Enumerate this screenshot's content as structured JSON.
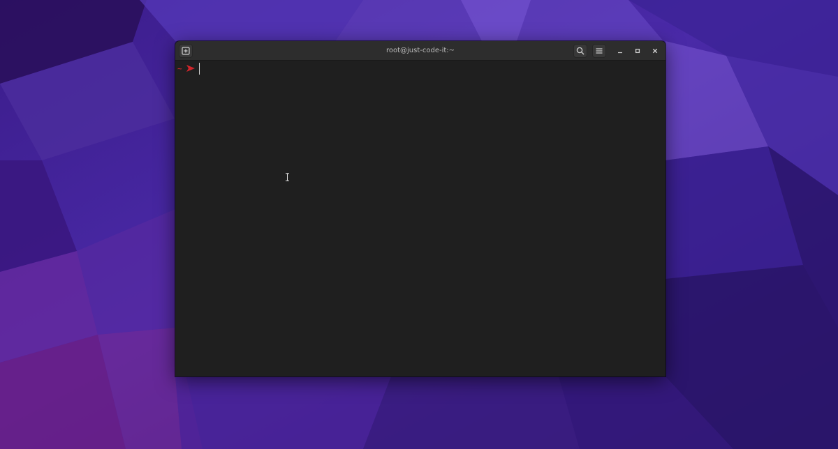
{
  "window": {
    "title": "root@just-code-it:~"
  },
  "terminal": {
    "prompt_symbol": "~",
    "prompt_arrow_color": "#d2252b",
    "input_text": ""
  },
  "headerbar": {
    "icons": [
      "new-tab-icon",
      "search-icon",
      "hamburger-menu-icon",
      "minimize-icon",
      "maximize-icon",
      "close-icon"
    ]
  },
  "colors": {
    "terminal_bg": "#1f1f1f",
    "headerbar_bg": "#2d2d2d",
    "prompt_accent": "#c3272b",
    "wallpaper_base": "#3a1e82"
  }
}
